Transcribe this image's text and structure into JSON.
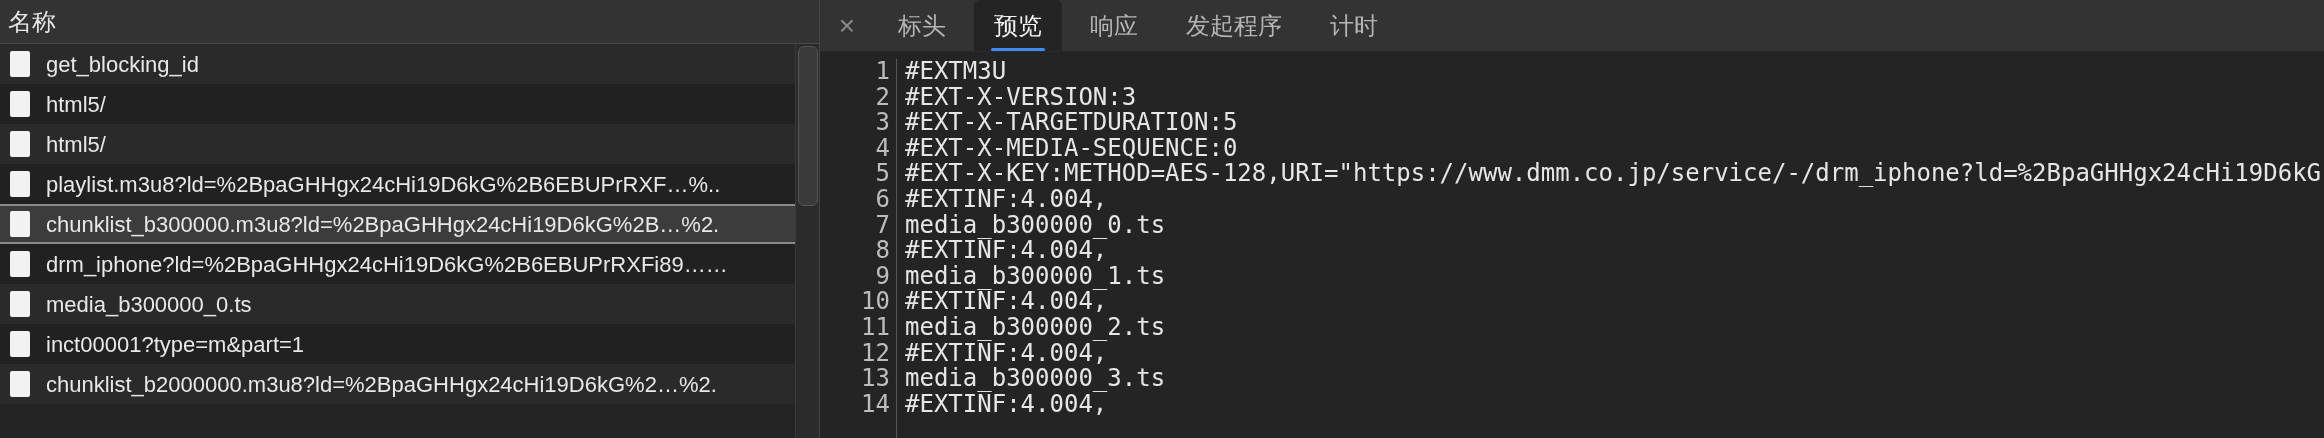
{
  "request_list": {
    "header": "名称",
    "rows": [
      {
        "name": "get_blocking_id",
        "selected": false,
        "error": false
      },
      {
        "name": "html5/",
        "selected": false,
        "error": false
      },
      {
        "name": "html5/",
        "selected": false,
        "error": false
      },
      {
        "name": "playlist.m3u8?ld=%2BpaGHHgx24cHi19D6kG%2B6EBUPrRXF…%..",
        "selected": false,
        "error": false
      },
      {
        "name": "chunklist_b300000.m3u8?ld=%2BpaGHHgx24cHi19D6kG%2B…%2.",
        "selected": true,
        "error": false
      },
      {
        "name": "drm_iphone?ld=%2BpaGHHgx24cHi19D6kG%2B6EBUPrRXFi89……",
        "selected": false,
        "error": false
      },
      {
        "name": "media_b300000_0.ts",
        "selected": false,
        "error": false
      },
      {
        "name": "inct00001?type=m&part=1",
        "selected": false,
        "error": false
      },
      {
        "name": "chunklist_b2000000.m3u8?ld=%2BpaGHHgx24cHi19D6kG%2…%2.",
        "selected": false,
        "error": false
      }
    ]
  },
  "detail": {
    "close": "×",
    "tabs": [
      {
        "label": "标头",
        "selected": false
      },
      {
        "label": "预览",
        "selected": true
      },
      {
        "label": "响应",
        "selected": false
      },
      {
        "label": "发起程序",
        "selected": false
      },
      {
        "label": "计时",
        "selected": false
      }
    ],
    "lines": [
      {
        "number": "1",
        "text": "#EXTM3U"
      },
      {
        "number": "2",
        "text": "#EXT-X-VERSION:3"
      },
      {
        "number": "3",
        "text": "#EXT-X-TARGETDURATION:5"
      },
      {
        "number": "4",
        "text": "#EXT-X-MEDIA-SEQUENCE:0"
      },
      {
        "number": "5",
        "text": "#EXT-X-KEY:METHOD=AES-128,URI=\"https://www.dmm.co.jp/service/-/drm_iphone?ld=%2BpaGHHgx24cHi19D6kG"
      },
      {
        "number": "6",
        "text": "#EXTINF:4.004,"
      },
      {
        "number": "7",
        "text": "media_b300000_0.ts"
      },
      {
        "number": "8",
        "text": "#EXTINF:4.004,"
      },
      {
        "number": "9",
        "text": "media_b300000_1.ts"
      },
      {
        "number": "10",
        "text": "#EXTINF:4.004,"
      },
      {
        "number": "11",
        "text": "media_b300000_2.ts"
      },
      {
        "number": "12",
        "text": "#EXTINF:4.004,"
      },
      {
        "number": "13",
        "text": "media_b300000_3.ts"
      },
      {
        "number": "14",
        "text": "#EXTINF:4.004,"
      }
    ]
  }
}
